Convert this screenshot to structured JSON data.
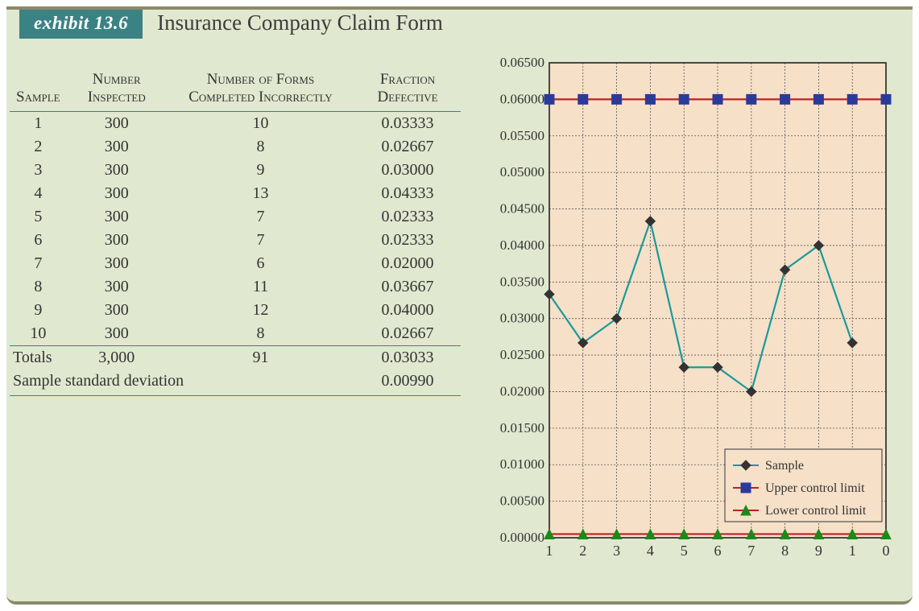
{
  "exhibit_label": "exhibit 13.6",
  "title": "Insurance Company Claim Form",
  "table": {
    "headers": {
      "sample": "Sample",
      "inspected": "Number Inspected",
      "incorrect": "Number of Forms Completed Incorrectly",
      "fraction": "Fraction Defective"
    },
    "rows": [
      {
        "sample": "1",
        "inspected": "300",
        "incorrect": "10",
        "fraction": "0.03333"
      },
      {
        "sample": "2",
        "inspected": "300",
        "incorrect": "8",
        "fraction": "0.02667"
      },
      {
        "sample": "3",
        "inspected": "300",
        "incorrect": "9",
        "fraction": "0.03000"
      },
      {
        "sample": "4",
        "inspected": "300",
        "incorrect": "13",
        "fraction": "0.04333"
      },
      {
        "sample": "5",
        "inspected": "300",
        "incorrect": "7",
        "fraction": "0.02333"
      },
      {
        "sample": "6",
        "inspected": "300",
        "incorrect": "7",
        "fraction": "0.02333"
      },
      {
        "sample": "7",
        "inspected": "300",
        "incorrect": "6",
        "fraction": "0.02000"
      },
      {
        "sample": "8",
        "inspected": "300",
        "incorrect": "11",
        "fraction": "0.03667"
      },
      {
        "sample": "9",
        "inspected": "300",
        "incorrect": "12",
        "fraction": "0.04000"
      },
      {
        "sample": "10",
        "inspected": "300",
        "incorrect": "8",
        "fraction": "0.02667"
      }
    ],
    "totals": {
      "label": "Totals",
      "inspected": "3,000",
      "incorrect": "91",
      "fraction": "0.03033"
    },
    "std": {
      "label": "Sample standard deviation",
      "value": "0.00990"
    }
  },
  "chart_data": {
    "type": "line",
    "x": [
      1,
      2,
      3,
      4,
      5,
      6,
      7,
      8,
      9,
      10,
      11
    ],
    "x_labels": [
      "1",
      "2",
      "3",
      "4",
      "5",
      "6",
      "7",
      "8",
      "9",
      "1",
      "0"
    ],
    "series": [
      {
        "name": "Sample",
        "color": "#1a9a9a",
        "marker": "diamond",
        "marker_color": "#333",
        "values": [
          0.03333,
          0.02667,
          0.03,
          0.04333,
          0.02333,
          0.02333,
          0.02,
          0.03667,
          0.04,
          0.02667
        ]
      },
      {
        "name": "Upper control limit",
        "color": "#c02020",
        "marker": "square",
        "marker_color": "#2a3a9a",
        "values": [
          0.06,
          0.06,
          0.06,
          0.06,
          0.06,
          0.06,
          0.06,
          0.06,
          0.06,
          0.06,
          0.06
        ]
      },
      {
        "name": "Lower control limit",
        "color": "#c02020",
        "marker": "triangle",
        "marker_color": "#1a8a1a",
        "values": [
          0.0005,
          0.0005,
          0.0005,
          0.0005,
          0.0005,
          0.0005,
          0.0005,
          0.0005,
          0.0005,
          0.0005,
          0.0005
        ]
      }
    ],
    "y_ticks": [
      0.0,
      0.005,
      0.01,
      0.015,
      0.02,
      0.025,
      0.03,
      0.035,
      0.04,
      0.045,
      0.05,
      0.055,
      0.06,
      0.065
    ],
    "ylim": [
      0,
      0.065
    ],
    "legend_position": "bottom-right",
    "plot_bg": "#f6e0c8"
  }
}
